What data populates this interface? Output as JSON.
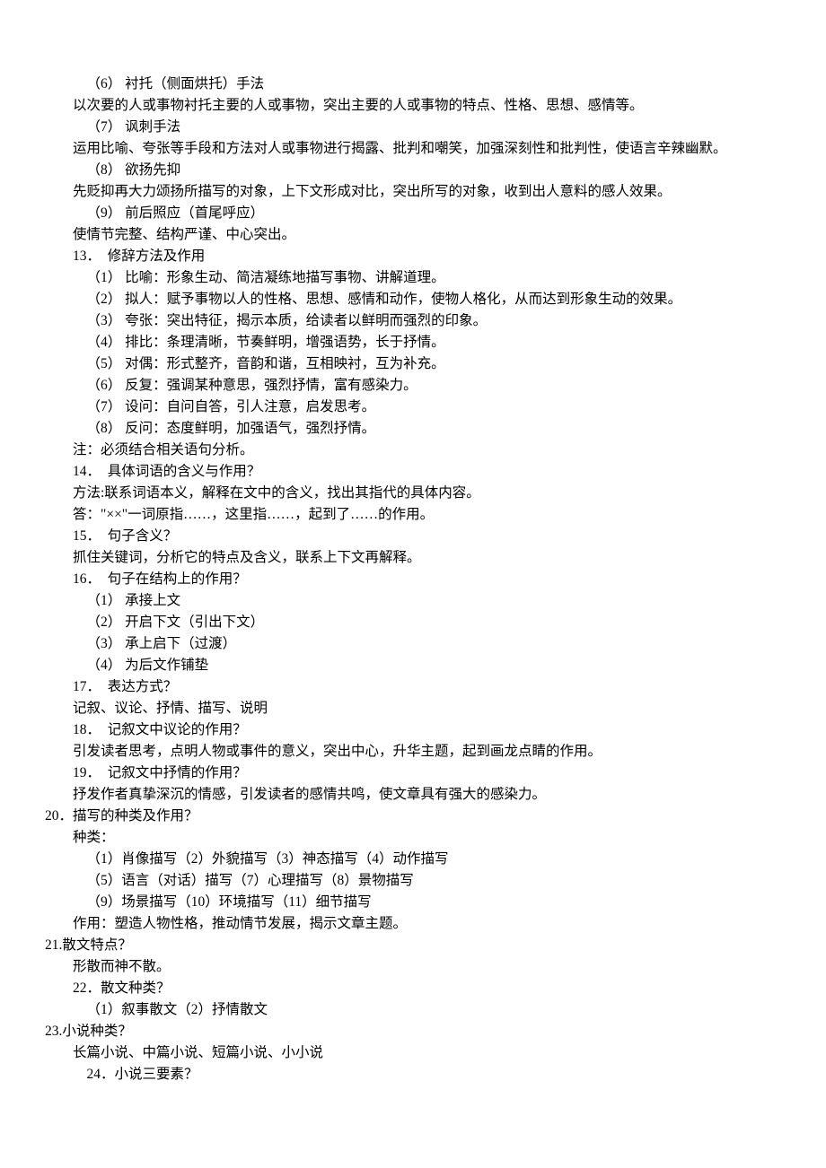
{
  "lines": [
    {
      "cls": "indent3",
      "text": "（6） 衬托（侧面烘托）手法"
    },
    {
      "cls": "indent2",
      "text": "以次要的人或事物衬托主要的人或事物，突出主要的人或事物的特点、性格、思想、感情等。"
    },
    {
      "cls": "indent3",
      "text": "（7） 讽刺手法"
    },
    {
      "cls": "indent2",
      "text": "运用比喻、夸张等手段和方法对人或事物进行揭露、批判和嘲笑，加强深刻性和批判性，使语言辛辣幽默。"
    },
    {
      "cls": "indent3",
      "text": "（8） 欲扬先抑"
    },
    {
      "cls": "indent2",
      "text": "先贬抑再大力颂扬所描写的对象，上下文形成对比，突出所写的对象，收到出人意料的感人效果。"
    },
    {
      "cls": "indent3",
      "text": "（9） 前后照应（首尾呼应）"
    },
    {
      "cls": "indent2",
      "text": "使情节完整、结构严谨、中心突出。"
    },
    {
      "cls": "indent2",
      "text": "13．  修辞方法及作用"
    },
    {
      "cls": "indent3",
      "text": "（1） 比喻：形象生动、简洁凝练地描写事物、讲解道理。"
    },
    {
      "cls": "indent3",
      "text": "（2） 拟人：赋予事物以人的性格、思想、感情和动作，使物人格化，从而达到形象生动的效果。"
    },
    {
      "cls": "indent3",
      "text": "（3） 夸张：突出特征，揭示本质，给读者以鲜明而强烈的印象。"
    },
    {
      "cls": "indent3",
      "text": "（4） 排比：条理清晰，节奏鲜明，增强语势，长于抒情。"
    },
    {
      "cls": "indent3",
      "text": "（5） 对偶：形式整齐，音韵和谐，互相映衬，互为补充。"
    },
    {
      "cls": "indent3",
      "text": "（6） 反复：强调某种意思，强烈抒情，富有感染力。"
    },
    {
      "cls": "indent3",
      "text": "（7） 设问：自问自答，引人注意，启发思考。"
    },
    {
      "cls": "indent3",
      "text": "（8） 反问：态度鲜明，加强语气，强烈抒情。"
    },
    {
      "cls": "indent2",
      "text": "注：必须结合相关语句分析。"
    },
    {
      "cls": "indent2",
      "text": "14．  具体词语的含义与作用？"
    },
    {
      "cls": "indent2",
      "text": "方法:联系词语本义，解释在文中的含义，找出其指代的具体内容。"
    },
    {
      "cls": "indent2",
      "text": "答：\"××\"一词原指……，这里指……，起到了……的作用。"
    },
    {
      "cls": "indent2",
      "text": "15．  句子含义？"
    },
    {
      "cls": "indent2",
      "text": "抓住关键词，分析它的特点及含义，联系上下文再解释。"
    },
    {
      "cls": "indent2",
      "text": "16．  句子在结构上的作用？"
    },
    {
      "cls": "indent3",
      "text": "（1） 承接上文"
    },
    {
      "cls": "indent3",
      "text": "（2） 开启下文（引出下文）"
    },
    {
      "cls": "indent3",
      "text": "（3） 承上启下（过渡）"
    },
    {
      "cls": "indent3",
      "text": "（4） 为后文作铺垫"
    },
    {
      "cls": "indent2",
      "text": "17．  表达方式？"
    },
    {
      "cls": "indent2",
      "text": "记叙、议论、抒情、描写、说明"
    },
    {
      "cls": "indent2",
      "text": "18．  记叙文中议论的作用？"
    },
    {
      "cls": "indent2",
      "text": "引发读者思考，点明人物或事件的意义，突出中心，升华主题，起到画龙点睛的作用。"
    },
    {
      "cls": "indent2",
      "text": "19．  记叙文中抒情的作用？"
    },
    {
      "cls": "indent2",
      "text": "抒发作者真挚深沉的情感，引发读者的感情共鸣，使文章具有强大的感染力。"
    },
    {
      "cls": "indent0",
      "text": "20．描写的种类及作用？"
    },
    {
      "cls": "indent2",
      "text": "种类："
    },
    {
      "cls": "indent3",
      "text": "（1）肖像描写（2）外貌描写（3）神态描写（4）动作描写"
    },
    {
      "cls": "indent3",
      "text": "（5）语言（对话）描写（7）心理描写（8）景物描写"
    },
    {
      "cls": "indent3",
      "text": "（9）场景描写（10）环境描写（11）细节描写"
    },
    {
      "cls": "indent2",
      "text": "作用：塑造人物性格，推动情节发展，揭示文章主题。"
    },
    {
      "cls": "indent0",
      "text": "21.散文特点？"
    },
    {
      "cls": "indent2",
      "text": "形散而神不散。"
    },
    {
      "cls": "indent2",
      "text": "22．散文种类？"
    },
    {
      "cls": "indent3",
      "text": "（1）叙事散文（2）抒情散文"
    },
    {
      "cls": "indent0",
      "text": "23.小说种类？"
    },
    {
      "cls": "indent2",
      "text": "长篇小说、中篇小说、短篇小说、小小说"
    },
    {
      "cls": "indent3",
      "text": "24．小说三要素？"
    }
  ]
}
